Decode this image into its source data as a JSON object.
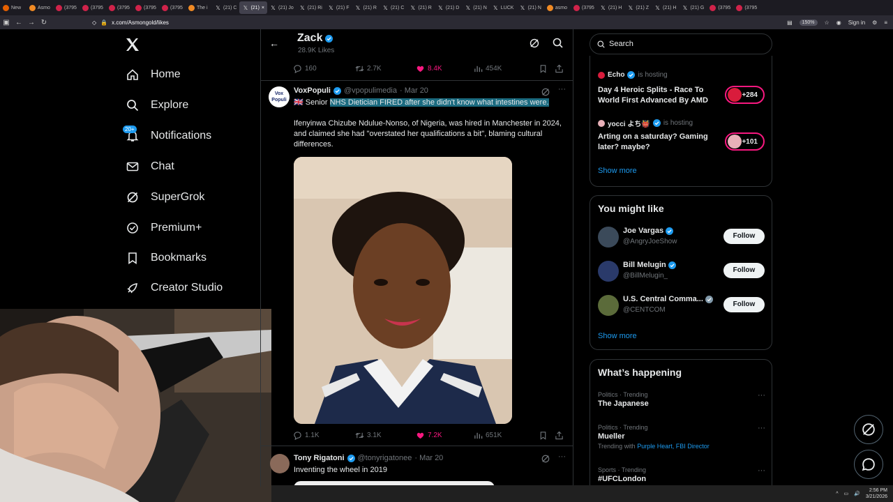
{
  "browser": {
    "tabs": [
      {
        "label": "New",
        "icon": "firefox-icon"
      },
      {
        "label": "Asmo",
        "icon": "app-icon"
      },
      {
        "label": "(3795",
        "icon": "youtube-icon"
      },
      {
        "label": "(3795",
        "icon": "youtube-icon"
      },
      {
        "label": "(3795",
        "icon": "youtube-icon"
      },
      {
        "label": "(3795",
        "icon": "youtube-icon"
      },
      {
        "label": "(3795",
        "icon": "youtube-icon"
      },
      {
        "label": "The i",
        "icon": "app-icon"
      },
      {
        "label": "(21) C",
        "icon": "x-icon"
      },
      {
        "label": "(21)",
        "icon": "x-icon",
        "active": true
      },
      {
        "label": "(21) Jo",
        "icon": "x-icon"
      },
      {
        "label": "(21) Ri",
        "icon": "x-icon"
      },
      {
        "label": "(21) F",
        "icon": "x-icon"
      },
      {
        "label": "(21) R",
        "icon": "x-icon"
      },
      {
        "label": "(21) C",
        "icon": "x-icon"
      },
      {
        "label": "(21) R",
        "icon": "x-icon"
      },
      {
        "label": "(21) D",
        "icon": "x-icon"
      },
      {
        "label": "(21) N",
        "icon": "x-icon"
      },
      {
        "label": "LUCK",
        "icon": "x-icon"
      },
      {
        "label": "(21) N",
        "icon": "x-icon"
      },
      {
        "label": "asmo",
        "icon": "app-icon"
      },
      {
        "label": "(3795",
        "icon": "youtube-icon"
      },
      {
        "label": "(21) H",
        "icon": "x-icon"
      },
      {
        "label": "(21) Z",
        "icon": "x-icon"
      },
      {
        "label": "(21) H",
        "icon": "x-icon"
      },
      {
        "label": "(21) G",
        "icon": "x-icon"
      },
      {
        "label": "(3795",
        "icon": "youtube-icon"
      },
      {
        "label": "(3795",
        "icon": "youtube-icon"
      }
    ],
    "url": "x.com/Asmongold/likes",
    "zoom": "150%",
    "sign_in": "Sign in"
  },
  "sidebar": {
    "notif_badge": "20+",
    "items": [
      {
        "label": "Home",
        "icon": "home-icon"
      },
      {
        "label": "Explore",
        "icon": "search-icon"
      },
      {
        "label": "Notifications",
        "icon": "bell-icon"
      },
      {
        "label": "Chat",
        "icon": "mail-icon"
      },
      {
        "label": "SuperGrok",
        "icon": "grok-icon"
      },
      {
        "label": "Premium+",
        "icon": "verified-icon"
      },
      {
        "label": "Bookmarks",
        "icon": "bookmark-icon"
      },
      {
        "label": "Creator Studio",
        "icon": "rocket-icon"
      }
    ]
  },
  "header": {
    "name": "Zack",
    "likes": "28.9K Likes"
  },
  "top_actions": {
    "replies": "160",
    "reposts": "2.7K",
    "likes": "8.4K",
    "views": "454K"
  },
  "tweet1": {
    "name": "VoxPopuli",
    "handle": "@vpopulimedia",
    "date": "· Mar 20",
    "avatar_text": "Vox Populi",
    "line1_prefix": "🇬🇧 Senior ",
    "line1_highlight": "NHS Dietician FIRED after she didn't know what intestines were.",
    "body": "Ifenyinwa Chizube Ndulue-Nonso, of Nigeria, was hired in Manchester in 2024, and claimed she had \"overstated her qualifications a bit\", blaming cultural differences.",
    "actions": {
      "replies": "1.1K",
      "reposts": "3.1K",
      "likes": "7.2K",
      "views": "651K"
    }
  },
  "tweet2": {
    "name": "Tony Rigatoni",
    "handle": "@tonyrigatonee",
    "date": "· Mar 20",
    "text": "Inventing the wheel in 2019"
  },
  "right": {
    "search_placeholder": "Search",
    "spaces": [
      {
        "host": "Echo",
        "status": "is hosting",
        "title": "Day 4 Heroic Splits - Race To World First Advanced By AMD",
        "count": "+284"
      },
      {
        "host": "yocci よち👹",
        "status": "is hosting",
        "title": "Arting on a saturday? Gaming later? maybe?",
        "count": "+101"
      }
    ],
    "show_more": "Show more",
    "might_like_title": "You might like",
    "might_like": [
      {
        "name": "Joe Vargas",
        "handle": "@AngryJoeShow",
        "button": "Follow",
        "badge": "blue"
      },
      {
        "name": "Bill Melugin",
        "handle": "@BillMelugin_",
        "button": "Follow",
        "badge": "blue"
      },
      {
        "name": "U.S. Central Comma...",
        "handle": "@CENTCOM",
        "button": "Follow",
        "badge": "gray"
      }
    ],
    "happening_title": "What’s happening",
    "trends": [
      {
        "context": "Politics · Trending",
        "title": "The Japanese",
        "with_prefix": "",
        "with": ""
      },
      {
        "context": "Politics · Trending",
        "title": "Mueller",
        "with_prefix": "Trending with ",
        "with": "Purple Heart, FBI Director"
      },
      {
        "context": "Sports · Trending",
        "title": "#UFCLondon",
        "with_prefix": "",
        "with": ""
      }
    ]
  },
  "taskbar": {
    "time": "2:56 PM",
    "date": "3/21/2026"
  },
  "colors": {
    "accent": "#1d9bf0",
    "like": "#f91880",
    "background": "#000000",
    "border": "#2f3336",
    "muted": "#71767b"
  }
}
